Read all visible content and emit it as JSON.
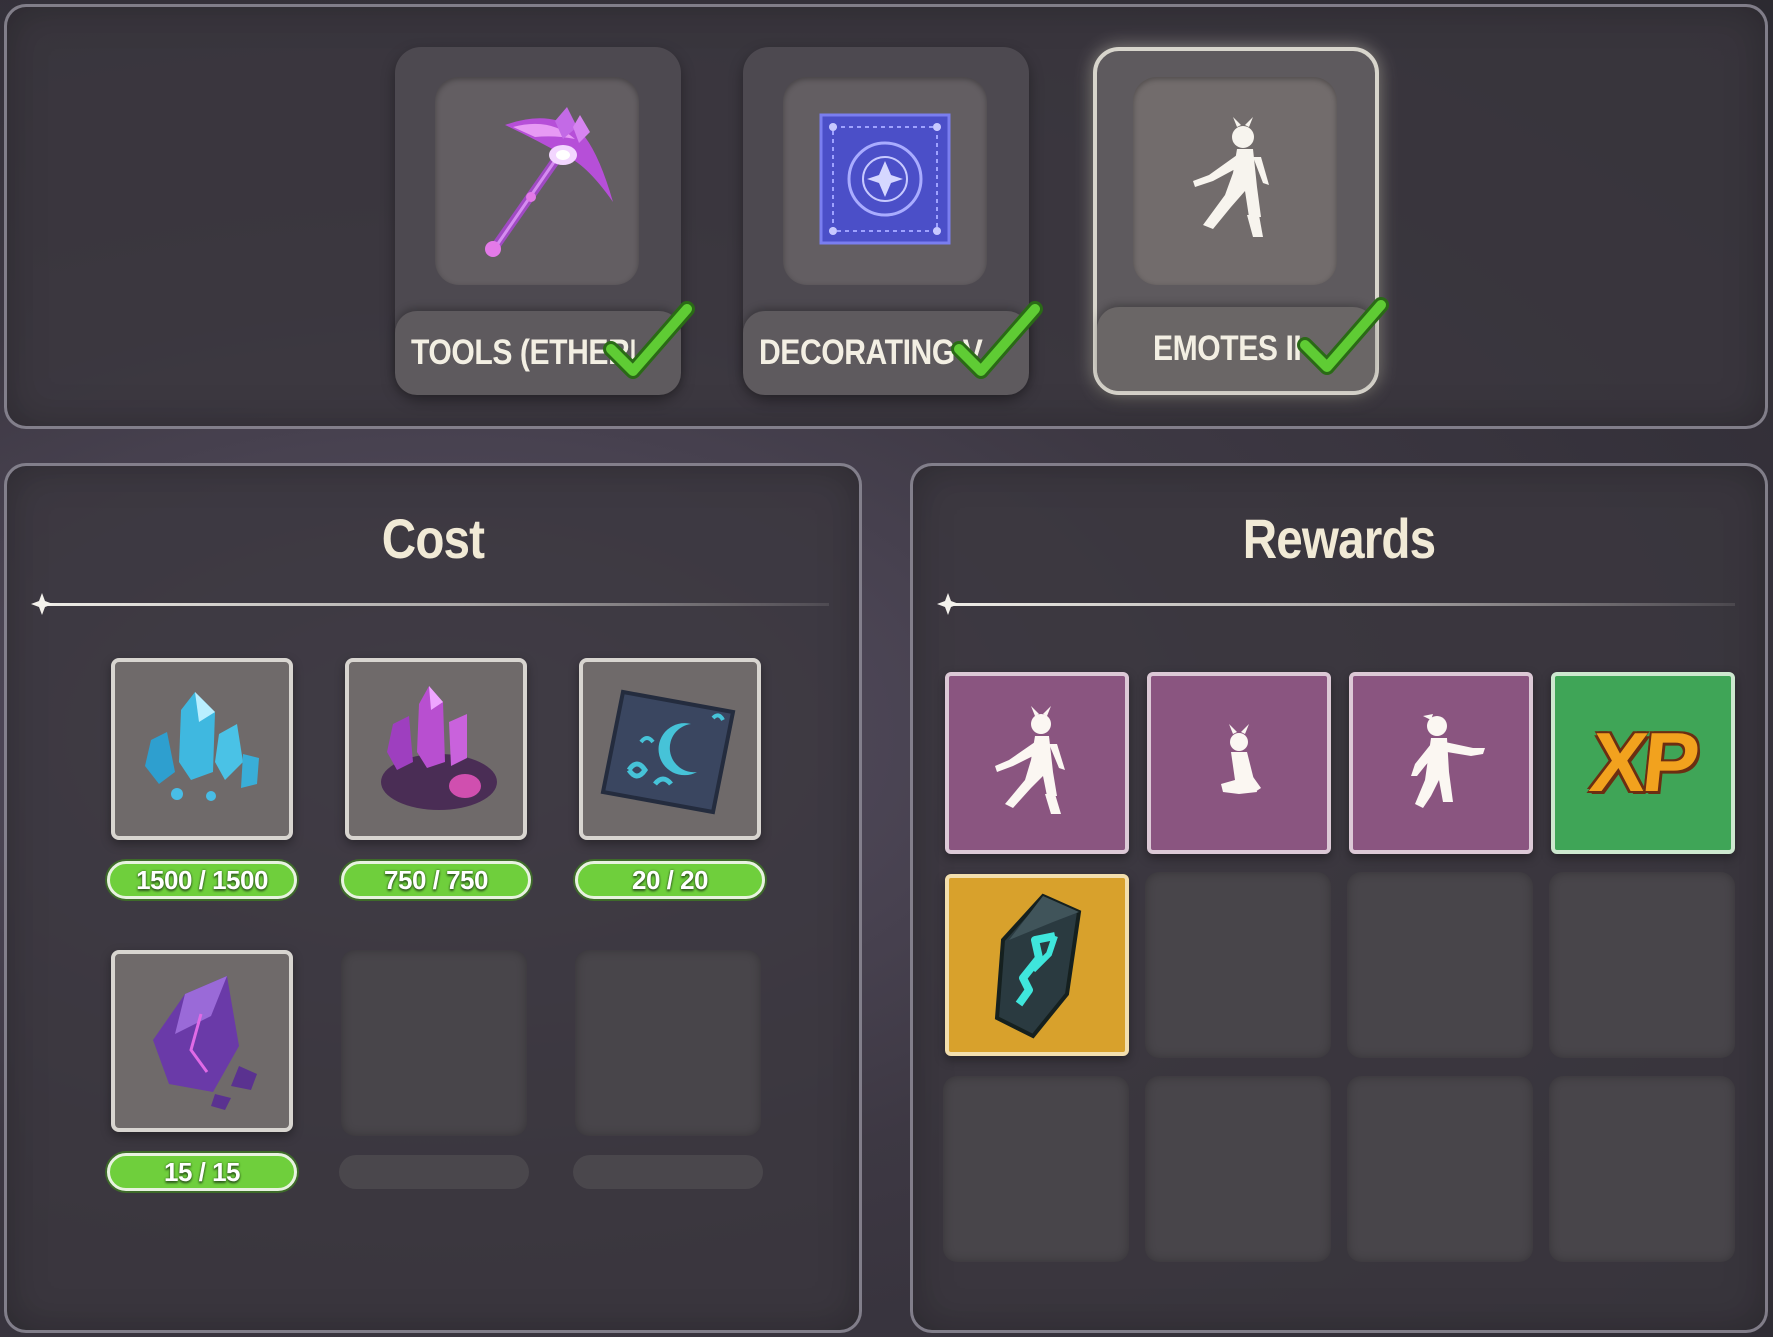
{
  "milestones": [
    {
      "label": "TOOLS (ETHERITE)",
      "icon": "etherite-pickaxe-icon",
      "completed": true,
      "selected": false
    },
    {
      "label": "DECORATING VI",
      "icon": "blue-rug-icon",
      "completed": true,
      "selected": false
    },
    {
      "label": "EMOTES II",
      "icon": "emote-pose-icon",
      "completed": true,
      "selected": true
    }
  ],
  "cost": {
    "title": "Cost",
    "items": [
      {
        "icon": "blue-crystal-cluster-icon",
        "amount": "1500 / 1500"
      },
      {
        "icon": "purple-crystal-ore-icon",
        "amount": "750 / 750"
      },
      {
        "icon": "moon-rune-tablet-icon",
        "amount": "20 / 20"
      },
      {
        "icon": "purple-gem-shard-icon",
        "amount": "15 / 15"
      }
    ]
  },
  "rewards": {
    "title": "Rewards",
    "items": [
      {
        "icon": "emote-lunge-icon",
        "type": "emote"
      },
      {
        "icon": "emote-kneel-icon",
        "type": "emote"
      },
      {
        "icon": "emote-point-icon",
        "type": "emote"
      },
      {
        "icon": "xp-icon",
        "type": "xp",
        "text": "XP"
      },
      {
        "icon": "rune-stone-icon",
        "type": "rune"
      }
    ]
  },
  "colors": {
    "progress_green": "#6fcf3c",
    "emote_purple": "#8a5580",
    "xp_green": "#3fa557",
    "rune_gold": "#d8a12c",
    "check_green": "#55c72f"
  }
}
